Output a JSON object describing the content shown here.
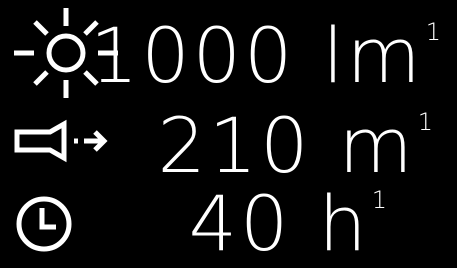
{
  "specs": [
    {
      "icon": "sun-icon",
      "value": "1000",
      "unit": "lm",
      "footnote": "1"
    },
    {
      "icon": "flashlight-beam-icon",
      "value": "210",
      "unit": "m",
      "footnote": "1"
    },
    {
      "icon": "clock-icon",
      "value": "40",
      "unit": "h",
      "footnote": "1"
    }
  ],
  "colors": {
    "background": "#000000",
    "foreground": "#ffffff"
  }
}
